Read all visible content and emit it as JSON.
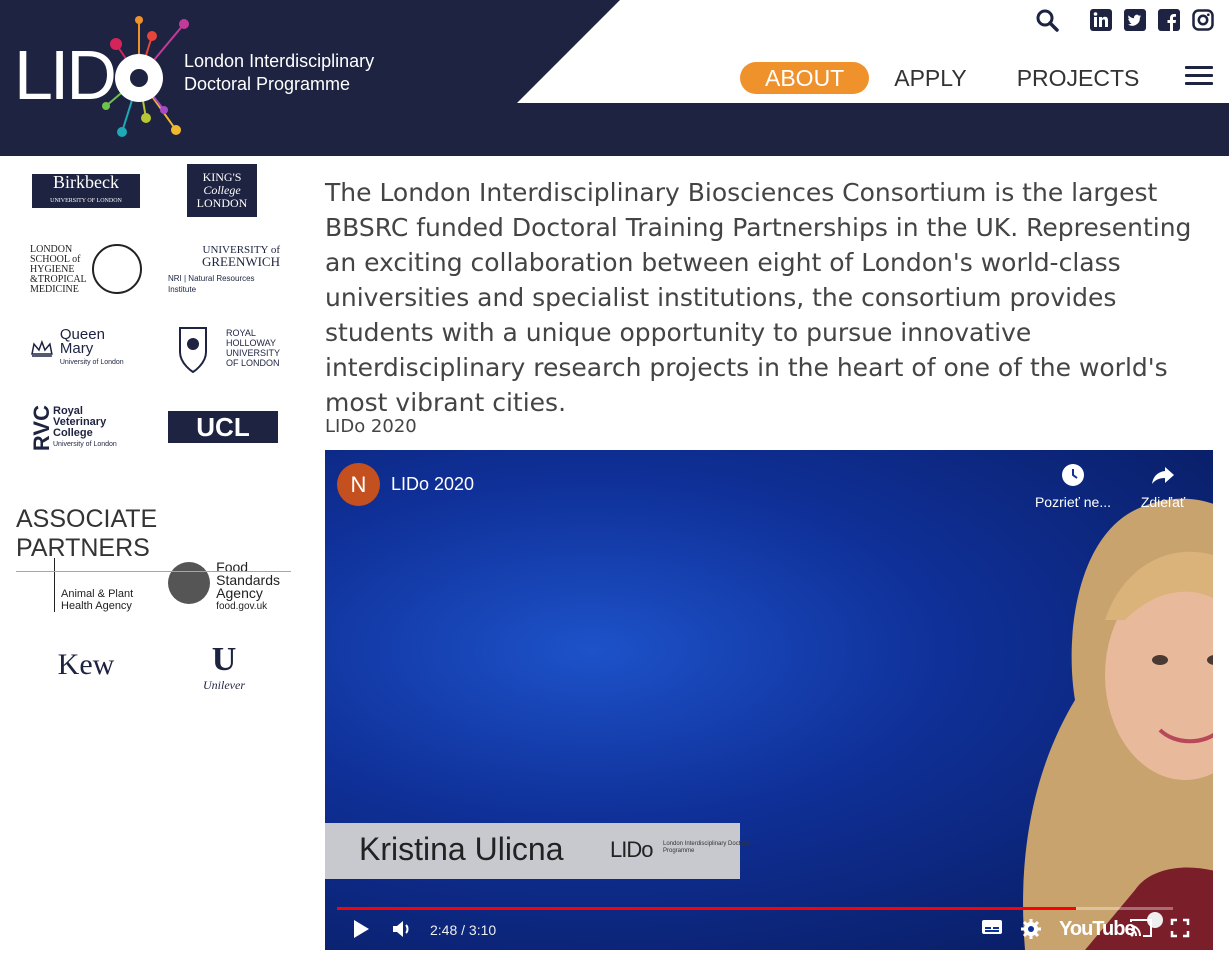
{
  "header": {
    "logo_word": "LID",
    "logo_sub_line1": "London Interdisciplinary",
    "logo_sub_line2": "Doctoral Programme",
    "nav": [
      {
        "label": "ABOUT",
        "active": true
      },
      {
        "label": "APPLY",
        "active": false
      },
      {
        "label": "PROJECTS",
        "active": false
      }
    ],
    "social_icons": [
      "search-icon",
      "linkedin-icon",
      "twitter-icon",
      "facebook-icon",
      "instagram-icon"
    ],
    "accent_color": "#f0922c",
    "navy_color": "#1d2340"
  },
  "partners": {
    "birkbeck": "Birkbeck",
    "birkbeck_sub": "UNIVERSITY OF LONDON",
    "kings_line1": "KING'S",
    "kings_line2": "College",
    "kings_line3": "LONDON",
    "lshtm": "LONDON SCHOOL of HYGIENE &TROPICAL MEDICINE",
    "greenwich_line1": "UNIVERSITY of",
    "greenwich_line2": "GREENWICH",
    "greenwich_line3": "NRI | Natural Resources Institute",
    "qmul": "Queen Mary",
    "qmul_sub": "University of London",
    "rhul": "ROYAL HOLLOWAY UNIVERSITY OF LONDON",
    "rvc_big": "RVC",
    "rvc_text": "Royal Veterinary College",
    "rvc_sub": "University of London",
    "ucl": "UCL"
  },
  "associate": {
    "title": "ASSOCIATE PARTNERS",
    "apha": "Animal & Plant Health Agency",
    "fsa_line1": "Food",
    "fsa_line2": "Standards",
    "fsa_line3": "Agency",
    "fsa_line4": "food.gov.uk",
    "kew": "Kew",
    "unilever": "Unilever"
  },
  "main": {
    "intro": "The London Interdisciplinary Biosciences Consortium is the largest BBSRC funded Doctoral Training Partnerships in the UK. Representing an exciting collaboration between eight of London's world-class universities and specialist institutions, the consortium provides students with a unique opportunity to pursue innovative interdisciplinary research projects in the heart of one of the world's most vibrant cities.",
    "video_heading": "LIDo 2020"
  },
  "video": {
    "channel_initial": "N",
    "title": "LIDo 2020",
    "watch_later": "Pozrieť ne...",
    "share": "Zdieľať",
    "caption_name": "Kristina Ulicna",
    "caption_logo": "LIDo",
    "caption_logo_sub": "London Interdisciplinary Doctoral Programme",
    "time": "2:48 / 3:10",
    "progress": 0.884,
    "youtube": "YouTube"
  }
}
